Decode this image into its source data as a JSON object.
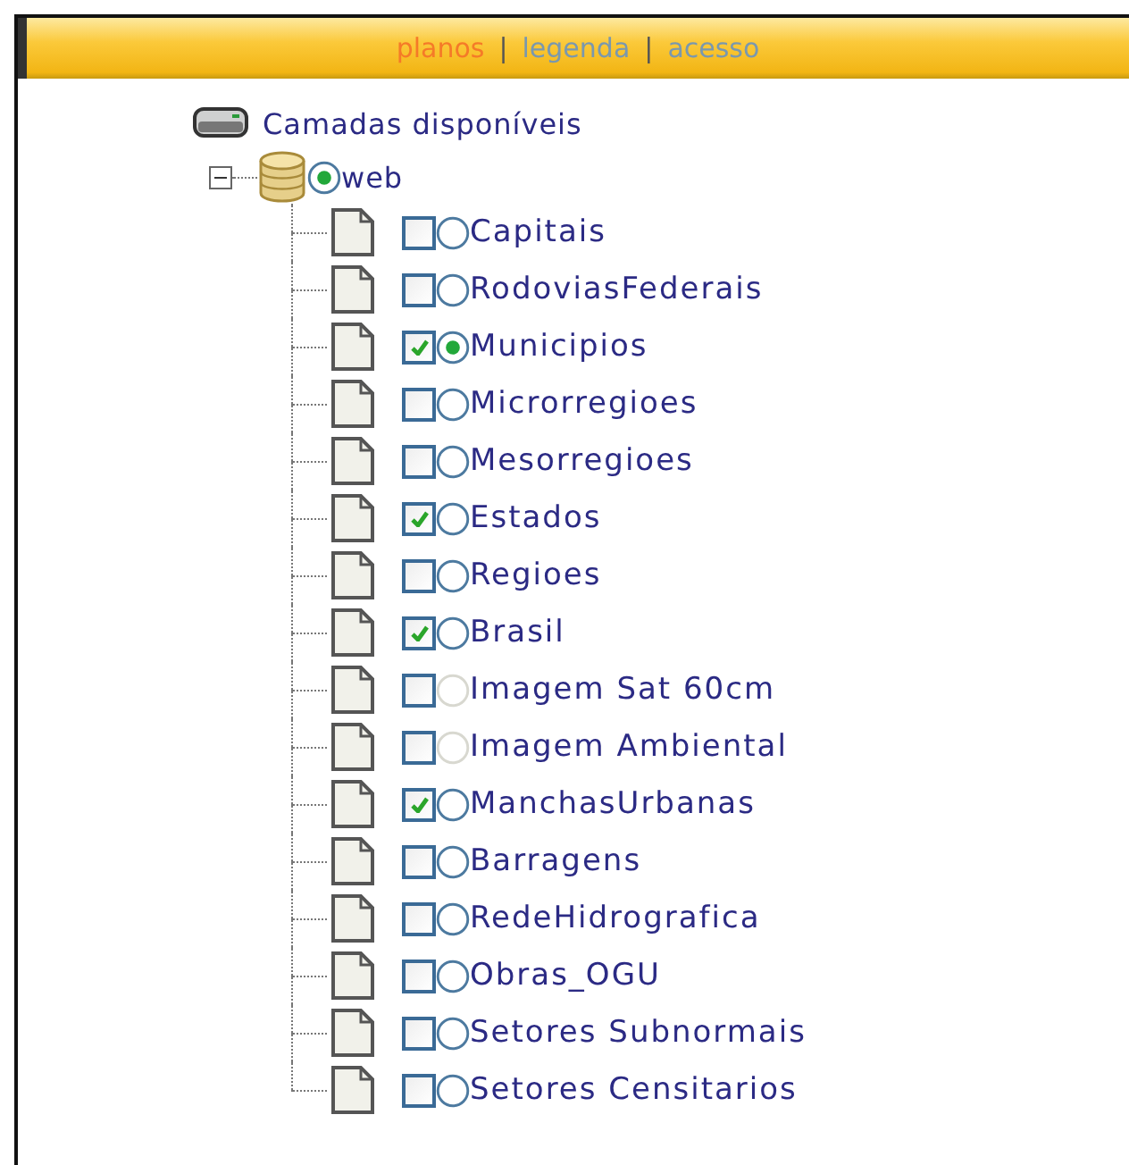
{
  "header": {
    "tabs": [
      {
        "label": "planos",
        "selected": true
      },
      {
        "label": "legenda",
        "selected": false
      },
      {
        "label": "acesso",
        "selected": false
      }
    ],
    "separators": [
      "|",
      "|"
    ]
  },
  "tree": {
    "label": "Camadas disponíveis",
    "children": [
      {
        "label": "web",
        "expanded": true,
        "selected": true,
        "children": [
          {
            "label": "Capitais",
            "checked": false,
            "selected": false,
            "disabled": false
          },
          {
            "label": "RodoviasFederais",
            "checked": false,
            "selected": false,
            "disabled": false
          },
          {
            "label": "Municipios",
            "checked": true,
            "selected": true,
            "disabled": false
          },
          {
            "label": "Microrregioes",
            "checked": false,
            "selected": false,
            "disabled": false
          },
          {
            "label": "Mesorregioes",
            "checked": false,
            "selected": false,
            "disabled": false
          },
          {
            "label": "Estados",
            "checked": true,
            "selected": false,
            "disabled": false
          },
          {
            "label": "Regioes",
            "checked": false,
            "selected": false,
            "disabled": false
          },
          {
            "label": "Brasil",
            "checked": true,
            "selected": false,
            "disabled": false
          },
          {
            "label": "Imagem Sat 60cm",
            "checked": false,
            "selected": false,
            "disabled": true
          },
          {
            "label": "Imagem Ambiental",
            "checked": false,
            "selected": false,
            "disabled": true
          },
          {
            "label": "ManchasUrbanas",
            "checked": true,
            "selected": false,
            "disabled": false
          },
          {
            "label": "Barragens",
            "checked": false,
            "selected": false,
            "disabled": false
          },
          {
            "label": "RedeHidrografica",
            "checked": false,
            "selected": false,
            "disabled": false
          },
          {
            "label": "Obras_OGU",
            "checked": false,
            "selected": false,
            "disabled": false
          },
          {
            "label": "Setores Subnormais",
            "checked": false,
            "selected": false,
            "disabled": false
          },
          {
            "label": "Setores Censitarios",
            "checked": false,
            "selected": false,
            "disabled": false
          }
        ]
      }
    ]
  }
}
